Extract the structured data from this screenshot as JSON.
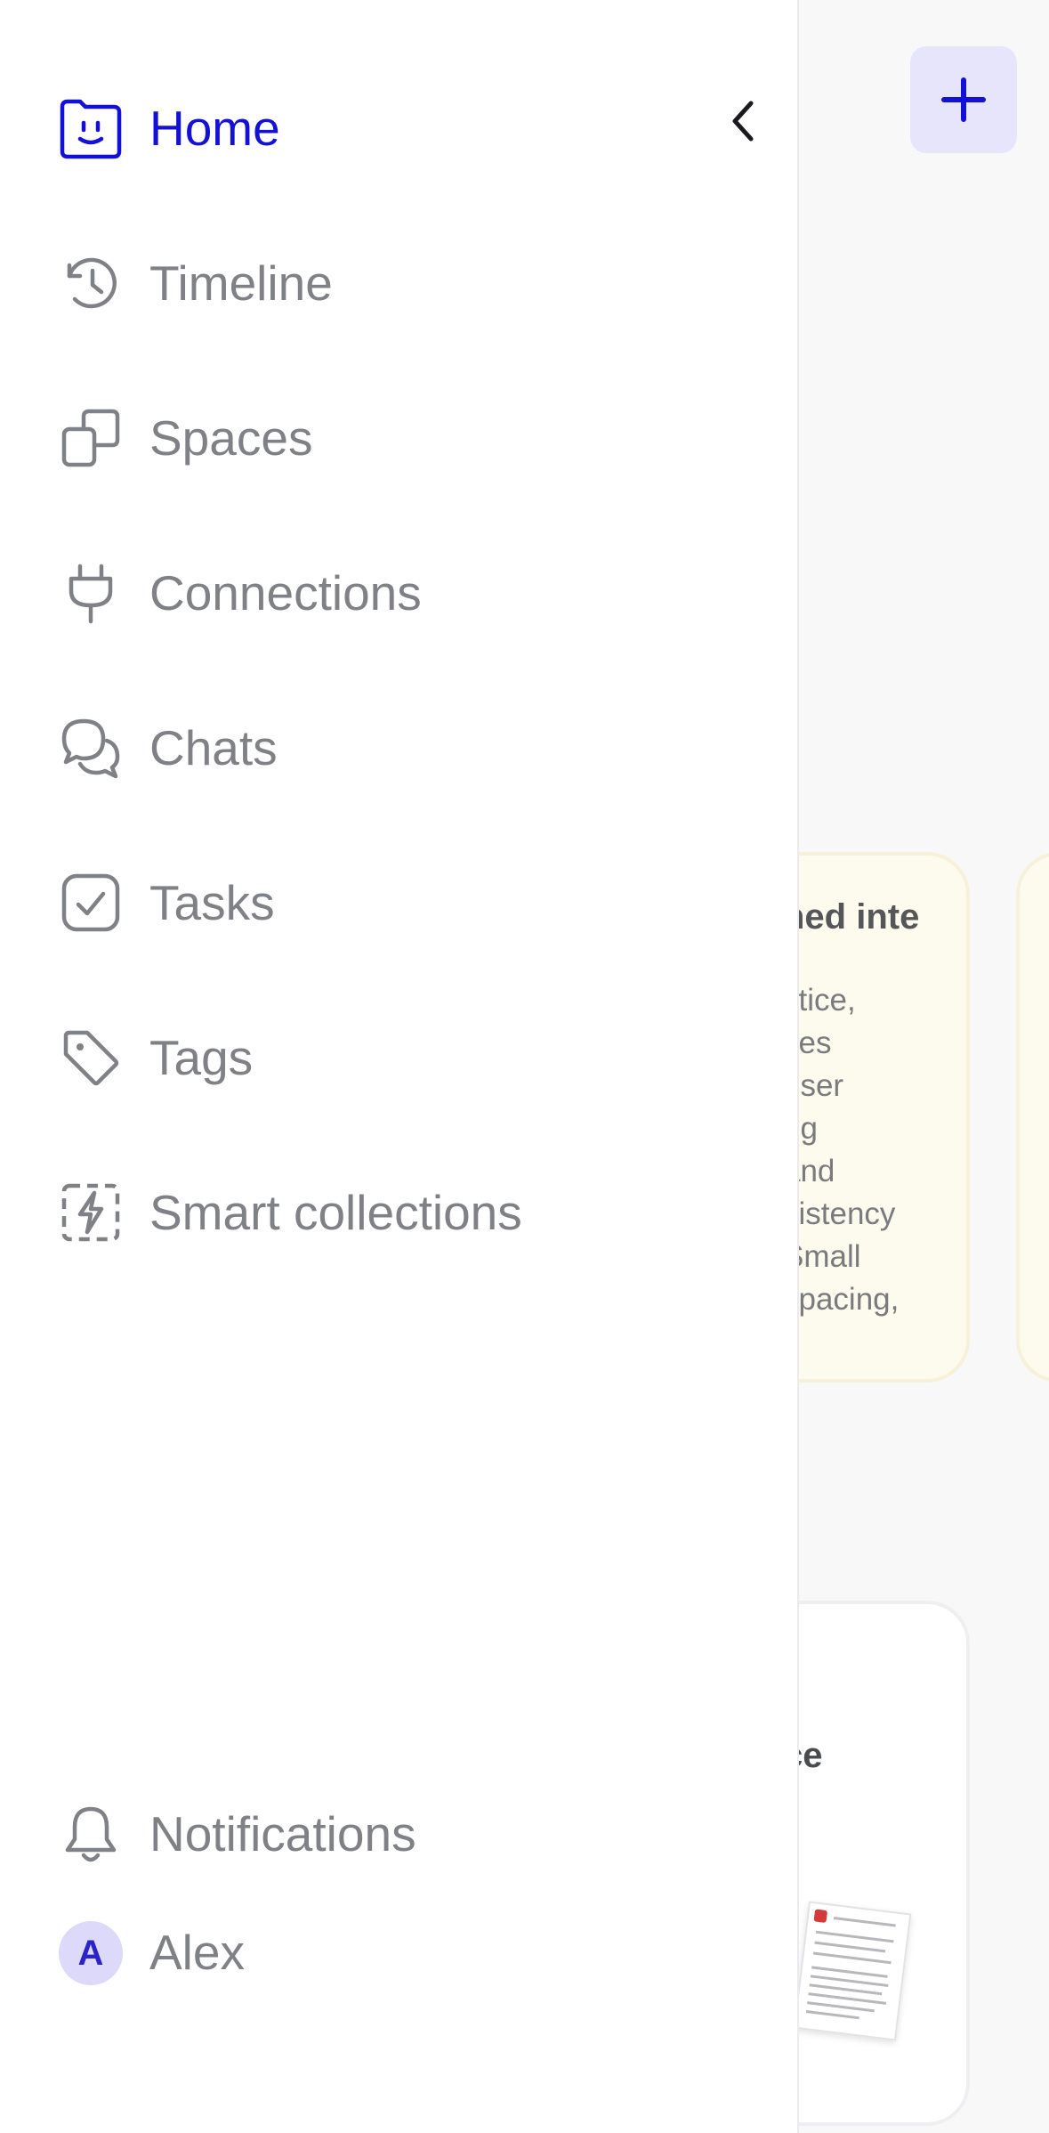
{
  "sidebar": {
    "items": [
      {
        "label": "Home",
        "icon": "home-smiley-folder-icon",
        "active": true
      },
      {
        "label": "Timeline",
        "icon": "clock-history-icon",
        "active": false
      },
      {
        "label": "Spaces",
        "icon": "spaces-squares-icon",
        "active": false
      },
      {
        "label": "Connections",
        "icon": "plug-icon",
        "active": false
      },
      {
        "label": "Chats",
        "icon": "chat-bubbles-icon",
        "active": false
      },
      {
        "label": "Tasks",
        "icon": "checkbox-icon",
        "active": false
      },
      {
        "label": "Tags",
        "icon": "tag-icon",
        "active": false
      },
      {
        "label": "Smart collections",
        "icon": "lightning-dashed-box-icon",
        "active": false
      }
    ],
    "footer": {
      "notifications_label": "Notifications",
      "user": {
        "initial": "A",
        "name": "Alex"
      }
    }
  },
  "background": {
    "cards": [
      {
        "title_fragment": "ned inte",
        "body_fragment": "ctice,\nves\nuser\nng\n and\nsistency\n Small\nspacing,\nd"
      },
      {
        "title_fragment": "ce"
      }
    ]
  },
  "colors": {
    "accent": "#1411d6",
    "accent_bg": "#e7e5fb",
    "muted_text": "#808186",
    "card_yellow": "#fdfbee"
  }
}
